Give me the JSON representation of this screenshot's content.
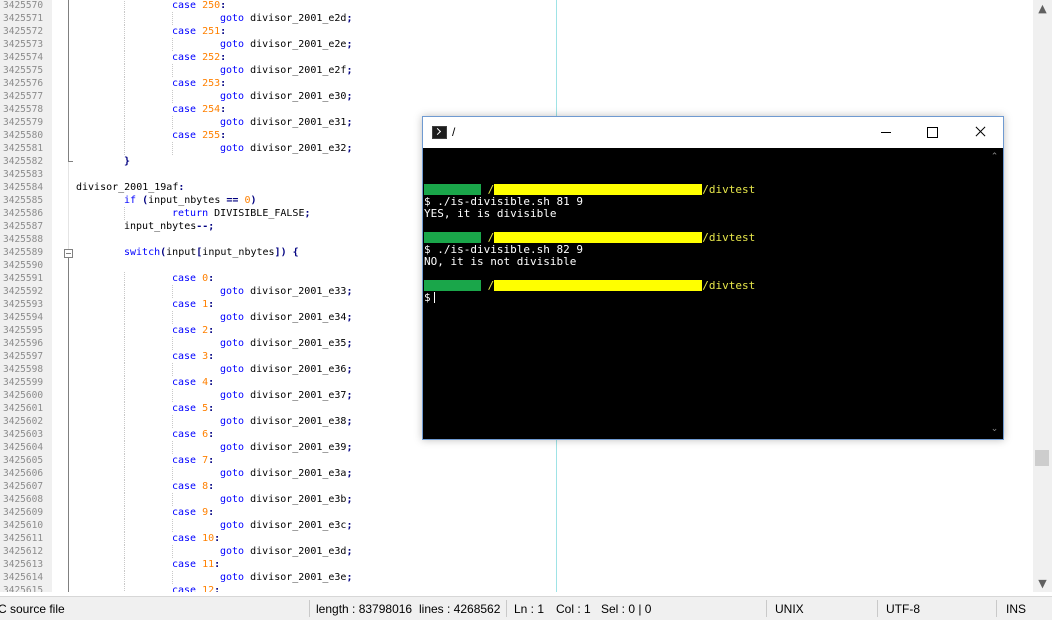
{
  "editor": {
    "lines": [
      {
        "n": "3425570",
        "tokens": [
          {
            "t": "case ",
            "c": "kw"
          },
          {
            "t": "250",
            "c": "num"
          },
          {
            "t": ":",
            "c": "op"
          }
        ],
        "indent": 2
      },
      {
        "n": "3425571",
        "tokens": [
          {
            "t": "goto ",
            "c": "kw"
          },
          {
            "t": "divisor_2001_e2d",
            "c": ""
          },
          {
            "t": ";",
            "c": "op"
          }
        ],
        "indent": 3
      },
      {
        "n": "3425572",
        "tokens": [
          {
            "t": "case ",
            "c": "kw"
          },
          {
            "t": "251",
            "c": "num"
          },
          {
            "t": ":",
            "c": "op"
          }
        ],
        "indent": 2
      },
      {
        "n": "3425573",
        "tokens": [
          {
            "t": "goto ",
            "c": "kw"
          },
          {
            "t": "divisor_2001_e2e",
            "c": ""
          },
          {
            "t": ";",
            "c": "op"
          }
        ],
        "indent": 3
      },
      {
        "n": "3425574",
        "tokens": [
          {
            "t": "case ",
            "c": "kw"
          },
          {
            "t": "252",
            "c": "num"
          },
          {
            "t": ":",
            "c": "op"
          }
        ],
        "indent": 2
      },
      {
        "n": "3425575",
        "tokens": [
          {
            "t": "goto ",
            "c": "kw"
          },
          {
            "t": "divisor_2001_e2f",
            "c": ""
          },
          {
            "t": ";",
            "c": "op"
          }
        ],
        "indent": 3
      },
      {
        "n": "3425576",
        "tokens": [
          {
            "t": "case ",
            "c": "kw"
          },
          {
            "t": "253",
            "c": "num"
          },
          {
            "t": ":",
            "c": "op"
          }
        ],
        "indent": 2
      },
      {
        "n": "3425577",
        "tokens": [
          {
            "t": "goto ",
            "c": "kw"
          },
          {
            "t": "divisor_2001_e30",
            "c": ""
          },
          {
            "t": ";",
            "c": "op"
          }
        ],
        "indent": 3
      },
      {
        "n": "3425578",
        "tokens": [
          {
            "t": "case ",
            "c": "kw"
          },
          {
            "t": "254",
            "c": "num"
          },
          {
            "t": ":",
            "c": "op"
          }
        ],
        "indent": 2
      },
      {
        "n": "3425579",
        "tokens": [
          {
            "t": "goto ",
            "c": "kw"
          },
          {
            "t": "divisor_2001_e31",
            "c": ""
          },
          {
            "t": ";",
            "c": "op"
          }
        ],
        "indent": 3
      },
      {
        "n": "3425580",
        "tokens": [
          {
            "t": "case ",
            "c": "kw"
          },
          {
            "t": "255",
            "c": "num"
          },
          {
            "t": ":",
            "c": "op"
          }
        ],
        "indent": 2
      },
      {
        "n": "3425581",
        "tokens": [
          {
            "t": "goto ",
            "c": "kw"
          },
          {
            "t": "divisor_2001_e32",
            "c": ""
          },
          {
            "t": ";",
            "c": "op"
          }
        ],
        "indent": 3
      },
      {
        "n": "3425582",
        "tokens": [
          {
            "t": "}",
            "c": "op"
          }
        ],
        "indent": 1
      },
      {
        "n": "3425583",
        "tokens": [],
        "indent": 0
      },
      {
        "n": "3425584",
        "tokens": [
          {
            "t": "divisor_2001_19af",
            "c": ""
          },
          {
            "t": ":",
            "c": "op"
          }
        ],
        "indent": 0
      },
      {
        "n": "3425585",
        "tokens": [
          {
            "t": "if ",
            "c": "kw"
          },
          {
            "t": "(",
            "c": "op"
          },
          {
            "t": "input_nbytes ",
            "c": ""
          },
          {
            "t": "==",
            "c": "op"
          },
          {
            "t": " ",
            "c": ""
          },
          {
            "t": "0",
            "c": "num"
          },
          {
            "t": ")",
            "c": "op"
          }
        ],
        "indent": 1
      },
      {
        "n": "3425586",
        "tokens": [
          {
            "t": "return ",
            "c": "kw"
          },
          {
            "t": "DIVISIBLE_FALSE",
            "c": ""
          },
          {
            "t": ";",
            "c": "op"
          }
        ],
        "indent": 2
      },
      {
        "n": "3425587",
        "tokens": [
          {
            "t": "input_nbytes",
            "c": ""
          },
          {
            "t": "--;",
            "c": "op"
          }
        ],
        "indent": 1
      },
      {
        "n": "3425588",
        "tokens": [],
        "indent": 0
      },
      {
        "n": "3425589",
        "tokens": [
          {
            "t": "switch",
            "c": "kw"
          },
          {
            "t": "(",
            "c": "op"
          },
          {
            "t": "input",
            "c": ""
          },
          {
            "t": "[",
            "c": "op"
          },
          {
            "t": "input_nbytes",
            "c": ""
          },
          {
            "t": "]) {",
            "c": "op"
          }
        ],
        "indent": 1
      },
      {
        "n": "3425590",
        "tokens": [],
        "indent": 0
      },
      {
        "n": "3425591",
        "tokens": [
          {
            "t": "case ",
            "c": "kw"
          },
          {
            "t": "0",
            "c": "num"
          },
          {
            "t": ":",
            "c": "op"
          }
        ],
        "indent": 2
      },
      {
        "n": "3425592",
        "tokens": [
          {
            "t": "goto ",
            "c": "kw"
          },
          {
            "t": "divisor_2001_e33",
            "c": ""
          },
          {
            "t": ";",
            "c": "op"
          }
        ],
        "indent": 3
      },
      {
        "n": "3425593",
        "tokens": [
          {
            "t": "case ",
            "c": "kw"
          },
          {
            "t": "1",
            "c": "num"
          },
          {
            "t": ":",
            "c": "op"
          }
        ],
        "indent": 2
      },
      {
        "n": "3425594",
        "tokens": [
          {
            "t": "goto ",
            "c": "kw"
          },
          {
            "t": "divisor_2001_e34",
            "c": ""
          },
          {
            "t": ";",
            "c": "op"
          }
        ],
        "indent": 3
      },
      {
        "n": "3425595",
        "tokens": [
          {
            "t": "case ",
            "c": "kw"
          },
          {
            "t": "2",
            "c": "num"
          },
          {
            "t": ":",
            "c": "op"
          }
        ],
        "indent": 2
      },
      {
        "n": "3425596",
        "tokens": [
          {
            "t": "goto ",
            "c": "kw"
          },
          {
            "t": "divisor_2001_e35",
            "c": ""
          },
          {
            "t": ";",
            "c": "op"
          }
        ],
        "indent": 3
      },
      {
        "n": "3425597",
        "tokens": [
          {
            "t": "case ",
            "c": "kw"
          },
          {
            "t": "3",
            "c": "num"
          },
          {
            "t": ":",
            "c": "op"
          }
        ],
        "indent": 2
      },
      {
        "n": "3425598",
        "tokens": [
          {
            "t": "goto ",
            "c": "kw"
          },
          {
            "t": "divisor_2001_e36",
            "c": ""
          },
          {
            "t": ";",
            "c": "op"
          }
        ],
        "indent": 3
      },
      {
        "n": "3425599",
        "tokens": [
          {
            "t": "case ",
            "c": "kw"
          },
          {
            "t": "4",
            "c": "num"
          },
          {
            "t": ":",
            "c": "op"
          }
        ],
        "indent": 2
      },
      {
        "n": "3425600",
        "tokens": [
          {
            "t": "goto ",
            "c": "kw"
          },
          {
            "t": "divisor_2001_e37",
            "c": ""
          },
          {
            "t": ";",
            "c": "op"
          }
        ],
        "indent": 3
      },
      {
        "n": "3425601",
        "tokens": [
          {
            "t": "case ",
            "c": "kw"
          },
          {
            "t": "5",
            "c": "num"
          },
          {
            "t": ":",
            "c": "op"
          }
        ],
        "indent": 2
      },
      {
        "n": "3425602",
        "tokens": [
          {
            "t": "goto ",
            "c": "kw"
          },
          {
            "t": "divisor_2001_e38",
            "c": ""
          },
          {
            "t": ";",
            "c": "op"
          }
        ],
        "indent": 3
      },
      {
        "n": "3425603",
        "tokens": [
          {
            "t": "case ",
            "c": "kw"
          },
          {
            "t": "6",
            "c": "num"
          },
          {
            "t": ":",
            "c": "op"
          }
        ],
        "indent": 2
      },
      {
        "n": "3425604",
        "tokens": [
          {
            "t": "goto ",
            "c": "kw"
          },
          {
            "t": "divisor_2001_e39",
            "c": ""
          },
          {
            "t": ";",
            "c": "op"
          }
        ],
        "indent": 3
      },
      {
        "n": "3425605",
        "tokens": [
          {
            "t": "case ",
            "c": "kw"
          },
          {
            "t": "7",
            "c": "num"
          },
          {
            "t": ":",
            "c": "op"
          }
        ],
        "indent": 2
      },
      {
        "n": "3425606",
        "tokens": [
          {
            "t": "goto ",
            "c": "kw"
          },
          {
            "t": "divisor_2001_e3a",
            "c": ""
          },
          {
            "t": ";",
            "c": "op"
          }
        ],
        "indent": 3
      },
      {
        "n": "3425607",
        "tokens": [
          {
            "t": "case ",
            "c": "kw"
          },
          {
            "t": "8",
            "c": "num"
          },
          {
            "t": ":",
            "c": "op"
          }
        ],
        "indent": 2
      },
      {
        "n": "3425608",
        "tokens": [
          {
            "t": "goto ",
            "c": "kw"
          },
          {
            "t": "divisor_2001_e3b",
            "c": ""
          },
          {
            "t": ";",
            "c": "op"
          }
        ],
        "indent": 3
      },
      {
        "n": "3425609",
        "tokens": [
          {
            "t": "case ",
            "c": "kw"
          },
          {
            "t": "9",
            "c": "num"
          },
          {
            "t": ":",
            "c": "op"
          }
        ],
        "indent": 2
      },
      {
        "n": "3425610",
        "tokens": [
          {
            "t": "goto ",
            "c": "kw"
          },
          {
            "t": "divisor_2001_e3c",
            "c": ""
          },
          {
            "t": ";",
            "c": "op"
          }
        ],
        "indent": 3
      },
      {
        "n": "3425611",
        "tokens": [
          {
            "t": "case ",
            "c": "kw"
          },
          {
            "t": "10",
            "c": "num"
          },
          {
            "t": ":",
            "c": "op"
          }
        ],
        "indent": 2
      },
      {
        "n": "3425612",
        "tokens": [
          {
            "t": "goto ",
            "c": "kw"
          },
          {
            "t": "divisor_2001_e3d",
            "c": ""
          },
          {
            "t": ";",
            "c": "op"
          }
        ],
        "indent": 3
      },
      {
        "n": "3425613",
        "tokens": [
          {
            "t": "case ",
            "c": "kw"
          },
          {
            "t": "11",
            "c": "num"
          },
          {
            "t": ":",
            "c": "op"
          }
        ],
        "indent": 2
      },
      {
        "n": "3425614",
        "tokens": [
          {
            "t": "goto ",
            "c": "kw"
          },
          {
            "t": "divisor_2001_e3e",
            "c": ""
          },
          {
            "t": ";",
            "c": "op"
          }
        ],
        "indent": 3
      },
      {
        "n": "3425615",
        "tokens": [
          {
            "t": "case ",
            "c": "kw"
          },
          {
            "t": "12",
            "c": "num"
          },
          {
            "t": ":",
            "c": "op"
          }
        ],
        "indent": 2
      }
    ],
    "fold_open_lines": [
      "3425589"
    ],
    "fold_end_lines": [
      "3425582"
    ],
    "colors": {
      "keyword": "#0000ff",
      "number": "#ff8000",
      "operator": "#000080",
      "edge_line": "#9fe3e6"
    }
  },
  "statusbar": {
    "file_type": "C source file",
    "length": "length : 83798016",
    "lines": "lines : 4268562",
    "ln": "Ln : 1",
    "col": "Col : 1",
    "sel": "Sel : 0 | 0",
    "eol": "UNIX",
    "encoding": "UTF-8",
    "mode": "INS"
  },
  "terminal": {
    "title": "/",
    "icon": "terminal-icon",
    "controls": {
      "minimize": "minimize-icon",
      "maximize": "maximize-icon",
      "close": "close-icon"
    },
    "prompt_path_prefix": "/",
    "prompt_path_suffix": "/divtest",
    "commands": [
      {
        "cmd": "$ ./is-divisible.sh 81 9",
        "output": "YES, it is divisible"
      },
      {
        "cmd": "$ ./is-divisible.sh 82 9",
        "output": "NO, it is not divisible"
      }
    ],
    "current_prompt": "$",
    "colors": {
      "background": "#000000",
      "text": "#ffffff",
      "path": "#e8e84b",
      "redact_user": "#1aa64a",
      "redact_host": "#ffff00"
    }
  }
}
